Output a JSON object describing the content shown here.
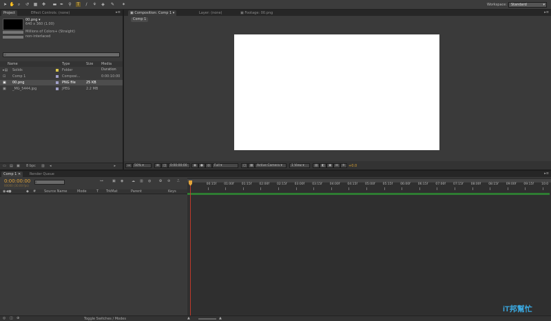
{
  "toolbar": {
    "workspace_label": "Workspace:",
    "workspace_value": "Standard"
  },
  "project_panel": {
    "tabs": [
      "Project",
      "Effect Controls: (none)"
    ],
    "selected_item": {
      "name": "00.png ▾",
      "dims": "640 x 360 (1.00)",
      "colors": "Millions of Colors+ (Straight)",
      "interlace": "non-interlaced"
    },
    "search_placeholder": "",
    "columns": [
      "Name",
      "Type",
      "Size",
      "Media Duration"
    ],
    "items": [
      {
        "name": "Solids",
        "type": "Folder",
        "size": "",
        "duration": "",
        "color": "#d9c54a"
      },
      {
        "name": "Comp 1",
        "type": "Composi...",
        "size": "",
        "duration": "0:00:10:00",
        "color": "#a0a0c8"
      },
      {
        "name": "00.png",
        "type": "PNG file",
        "size": "25 KB",
        "duration": "",
        "color": "#a0a0c8"
      },
      {
        "name": "_MG_5444.jpg",
        "type": "JPEG",
        "size": "2.2 MB",
        "duration": "",
        "color": "#a0a0c8"
      }
    ],
    "footer_bpc": "8 bpc"
  },
  "comp_panel": {
    "tabs": [
      "Composition: Comp 1",
      "Layer: (none)",
      "Footage: 00.png"
    ],
    "comp_tab": "Comp 1",
    "zoom": "50%",
    "timecode": "0:00:00:00",
    "resolution": "Full",
    "camera": "Active Camera",
    "view": "1 View",
    "exposure": "+0.0"
  },
  "timeline": {
    "tabs": [
      "Comp 1",
      "Render Queue"
    ],
    "timecode": "0:00:00:00",
    "frame_info": "00000 (30.00 fps)",
    "columns": [
      "#",
      "Source Name",
      "Mode",
      "T",
      "TrkMat",
      "Parent",
      "Keys"
    ],
    "ticks": [
      "0f",
      "00:15f",
      "01:00f",
      "01:15f",
      "02:00f",
      "02:15f",
      "03:00f",
      "03:15f",
      "04:00f",
      "04:15f",
      "05:00f",
      "05:15f",
      "06:00f",
      "06:15f",
      "07:00f",
      "07:15f",
      "08:00f",
      "08:15f",
      "09:00f",
      "09:15f",
      "10:0"
    ],
    "footer": "Toggle Switches / Modes"
  },
  "watermark": "iT邦幫忙"
}
